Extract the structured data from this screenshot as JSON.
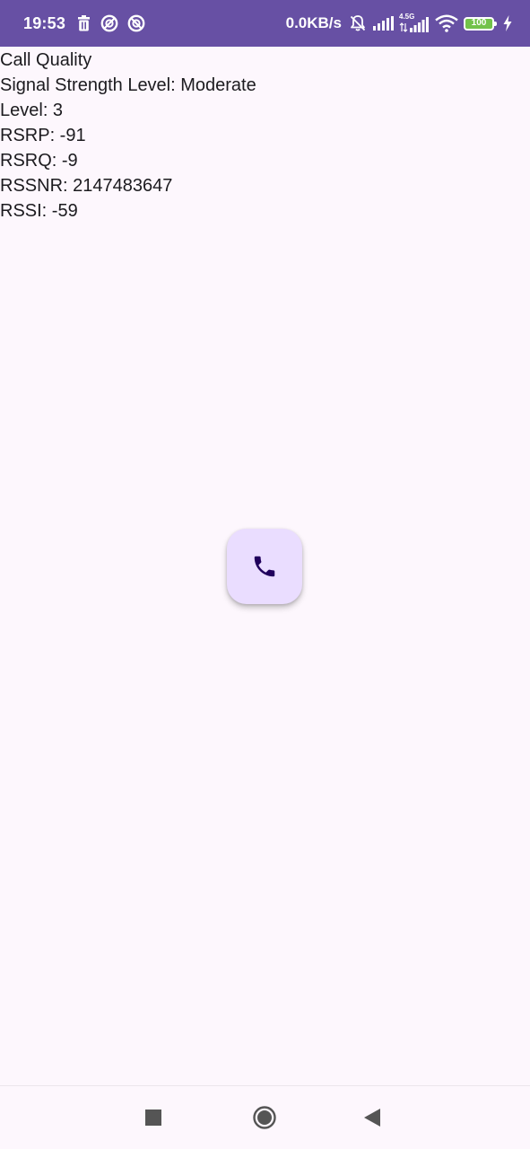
{
  "status_bar": {
    "time": "19:53",
    "net_speed": "0.0KB/s",
    "network_type": "4.5G",
    "battery_level": "100",
    "left_icons": [
      "trash-icon",
      "vpn-shield-icon",
      "blocked-circle-icon"
    ],
    "right_icons": [
      "bell-off-icon",
      "signal-icon",
      "signal-4-5g-icon",
      "wifi-icon",
      "battery-icon",
      "charging-bolt-icon"
    ],
    "background_color": "#6750a4"
  },
  "content": {
    "lines": [
      "Call Quality",
      "Signal Strength Level: Moderate",
      "Level: 3",
      "RSRP: -91",
      "RSRQ: -9",
      "RSSNR: 2147483647",
      "RSSI: -59"
    ]
  },
  "fab": {
    "icon": "phone-icon",
    "background_color": "#eaddff",
    "icon_color": "#21005d"
  },
  "nav_bar": {
    "buttons": [
      "recent-apps-button",
      "home-button",
      "back-button"
    ]
  }
}
